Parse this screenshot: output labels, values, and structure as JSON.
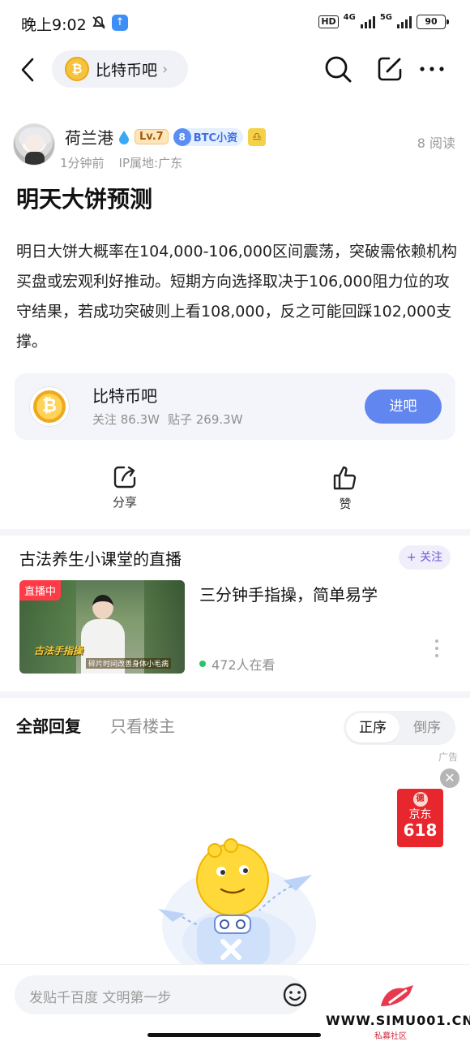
{
  "status_bar": {
    "time": "晚上9:02",
    "hd": "HD",
    "net1": "4G",
    "net2": "5G",
    "battery": "90"
  },
  "nav": {
    "forum_name": "比特币吧",
    "coin_symbol": "₿"
  },
  "post": {
    "author": "荷兰港",
    "level": "Lv.7",
    "badge_num": "8",
    "badge_label": "BTC小资",
    "zodiac_icon": "libra-icon",
    "time_ago": "1分钟前",
    "ip_location": "IP属地:广东",
    "read_count": "8 阅读",
    "title": "明天大饼预测",
    "body": "明日大饼大概率在104,000-106,000区间震荡，突破需依赖机构买盘或宏观利好推动。短期方向选择取决于106,000阻力位的攻守结果，若成功突破则上看108,000，反之可能回踩102,000支撑。"
  },
  "forum_card": {
    "name": "比特币吧",
    "followers": "关注 86.3W",
    "posts": "贴子 269.3W",
    "enter_label": "进吧"
  },
  "actions": {
    "share": "分享",
    "like": "赞"
  },
  "live": {
    "title": "古法养生小课堂的直播",
    "follow_label": "+ 关注",
    "badge": "直播中",
    "thumb_caption": "古法手指操",
    "thumb_sub": "碎片时间改善身体小毛病",
    "description": "三分钟手指操，简单易学",
    "viewers": "472人在看"
  },
  "replies": {
    "tab_all": "全部回复",
    "tab_op": "只看楼主",
    "sort_asc": "正序",
    "sort_desc": "倒序"
  },
  "ad": {
    "label": "广告",
    "seal": "德",
    "brand": "京东",
    "number": "618"
  },
  "bottom": {
    "input_placeholder": "发贴千百度 文明第一步"
  },
  "watermark": {
    "url": "WWW.SIMU001.CN",
    "sub": "私募社区"
  },
  "colors": {
    "accent": "#6186f0",
    "live_red": "#ff3b47",
    "online_green": "#2bc36b"
  }
}
